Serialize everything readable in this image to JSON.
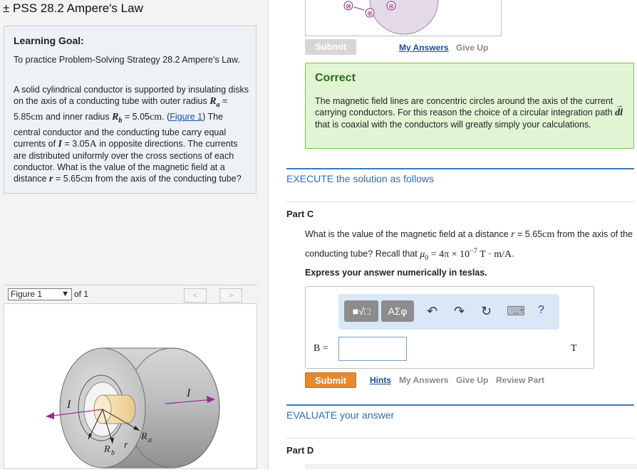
{
  "header": {
    "title": "± PSS 28.2 Ampere's Law"
  },
  "goal": {
    "heading": "Learning Goal:",
    "intro": "To practice Problem-Solving Strategy 28.2 Ampere's Law.",
    "p_a": "A solid cylindrical conductor is supported by insulating disks on the axis of a conducting tube with outer radius",
    "ra_sym": "R",
    "ra_sub": "a",
    "ra_val": "= 5.85",
    "ra_unit": "cm",
    "p_b": "and inner radius",
    "rb_sym": "R",
    "rb_sub": "b",
    "rb_val": "= 5.05",
    "rb_unit": "cm",
    "p_c": ". (",
    "fig_link": "Figure 1",
    "p_d": ") The central conductor and the conducting tube carry equal currents of",
    "i_sym": "I",
    "i_val": "= 3.05",
    "i_unit": "A",
    "p_e": "in opposite directions. The currents are distributed uniformly over the cross sections of each conductor. What is the value of the magnetic field at a distance",
    "r_sym": "r",
    "r_val": "= 5.65",
    "r_unit": "cm",
    "p_f": "from the axis of the conducting tube?"
  },
  "figure": {
    "select_value": "Figure 1",
    "of_label": "of 1",
    "prev": "<",
    "next": ">",
    "labels": {
      "I_left": "I",
      "I_right": "I",
      "Rb": "R",
      "Rb_sub": "b",
      "r": "r",
      "Ra": "R",
      "Ra_sub": "a"
    }
  },
  "prev_part": {
    "submit": "Submit",
    "my_answers": "My Answers",
    "give_up": "Give Up",
    "correct_title": "Correct",
    "correct_text_1": "The magnetic field lines are concentric circles around the axis of the current carrying conductors. For this reason the choice of a circular integration path",
    "correct_dl": "dl",
    "correct_text_2": "that is coaxial with the conductors will greatly simply your calculations."
  },
  "execute": {
    "title": "EXECUTE the solution as follows"
  },
  "part_c": {
    "label": "Part C",
    "q_1": "What is the value of the magnetic field at a distance",
    "q_r": "r",
    "q_rval": "= 5.65",
    "q_runit": "cm",
    "q_2": "from the axis of the conducting tube? Recall that",
    "q_mu": "μ",
    "q_mu_sub": "0",
    "q_mu_val": "= 4π × 10",
    "q_exp": "−7",
    "q_unit": "T · m/A",
    "q_end": ".",
    "instruction": "Express your answer numerically in teslas.",
    "answer_label": "B =",
    "answer_value": "",
    "answer_unit": "T",
    "toolbar": {
      "templates": "■√□",
      "greek": "ΑΣφ",
      "undo": "↶",
      "redo": "↷",
      "reset": "↻",
      "keyboard": "⌨",
      "help": "?"
    },
    "submit": "Submit",
    "hints": "Hints",
    "my_answers": "My Answers",
    "give_up": "Give Up",
    "review": "Review Part"
  },
  "evaluate": {
    "title": "EVALUATE your answer"
  },
  "part_d": {
    "label": "Part D"
  },
  "colors": {
    "accent": "#3a78bd",
    "submit": "#e8892e",
    "correct_bg": "#e1f5d5",
    "correct_border": "#7cbf4e"
  }
}
